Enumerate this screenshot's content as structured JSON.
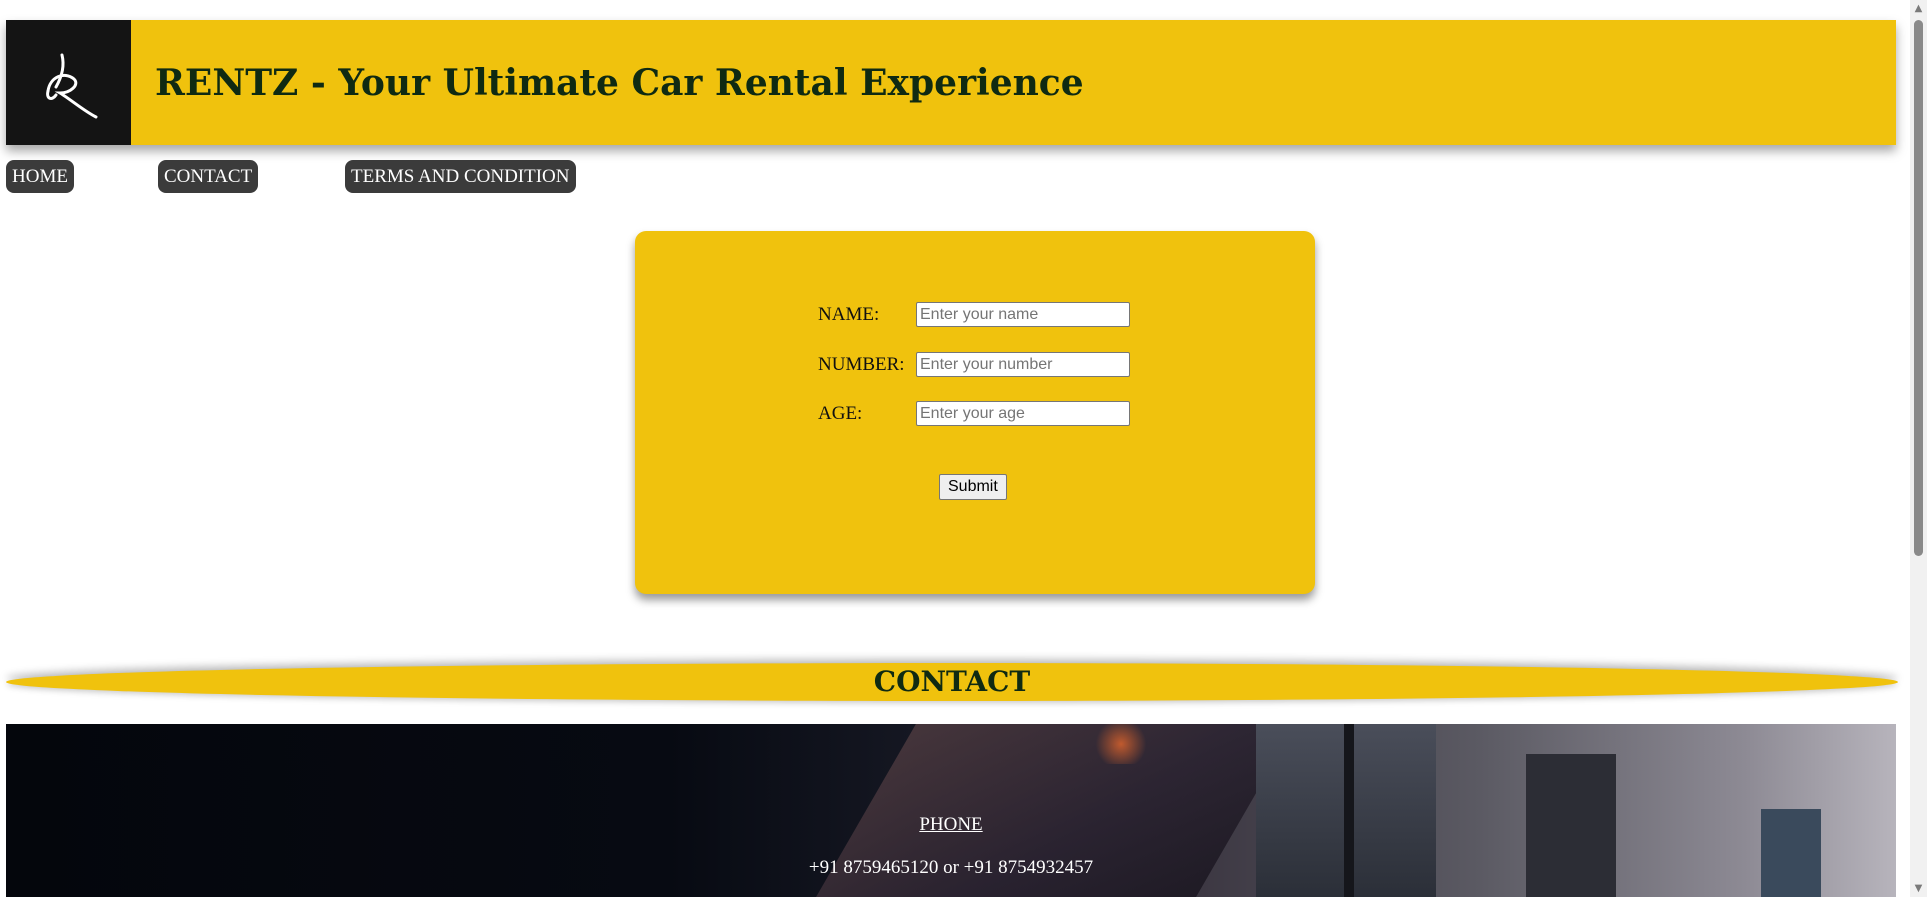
{
  "header": {
    "title": "RENTZ - Your Ultimate Car Rental Experience",
    "logo_icon": "rentz-logo-icon"
  },
  "nav": {
    "items": [
      {
        "label": "HOME"
      },
      {
        "label": "CONTACT"
      },
      {
        "label": "TERMS AND CONDITION"
      }
    ]
  },
  "form": {
    "name_label": "NAME:",
    "name_placeholder": "Enter your name",
    "number_label": "NUMBER:",
    "number_placeholder": "Enter your number",
    "age_label": "AGE:",
    "age_placeholder": "Enter your age",
    "submit_label": "Submit"
  },
  "contact": {
    "heading": "CONTACT",
    "phone_title": "PHONE",
    "phone_numbers": "+91 8759465120 or +91 8754932457"
  },
  "colors": {
    "accent_yellow": "#f0c20d",
    "title_green": "#0f2a12",
    "nav_bg": "#3b3b3b",
    "logo_bg": "#141414"
  }
}
